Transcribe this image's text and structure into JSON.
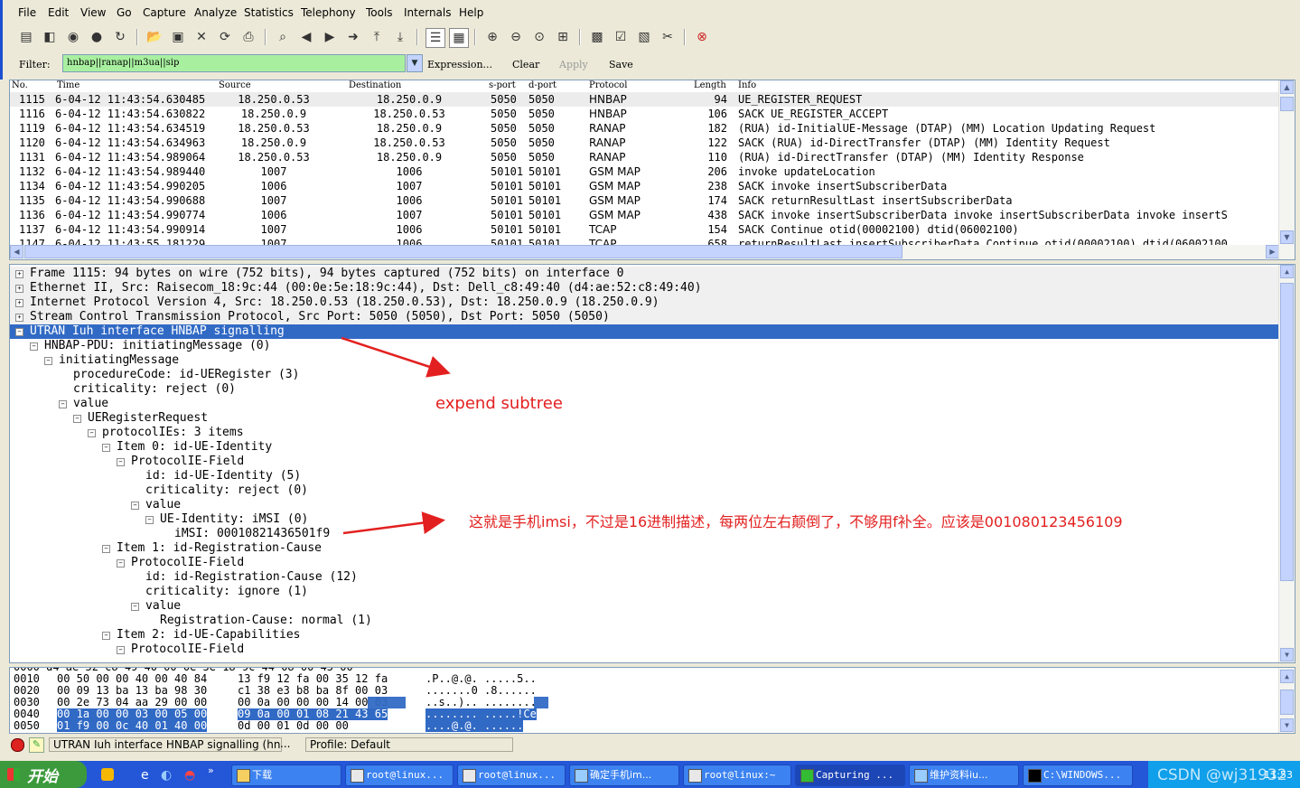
{
  "menu": [
    "File",
    "Edit",
    "View",
    "Go",
    "Capture",
    "Analyze",
    "Statistics",
    "Telephony",
    "Tools",
    "Internals",
    "Help"
  ],
  "filter": {
    "label": "Filter:",
    "value": "hnbap||ranap||m3ua||sip",
    "expression": "Expression...",
    "clear": "Clear",
    "apply": "Apply",
    "save": "Save"
  },
  "columns": [
    "No.",
    "Time",
    "Source",
    "Destination",
    "s-port",
    "d-port",
    "Protocol",
    "Length",
    "Info"
  ],
  "packets": [
    [
      "1115",
      "6-04-12 11:43:54.630485",
      "18.250.0.53",
      "18.250.0.9",
      "5050",
      "5050",
      "HNBAP",
      "94",
      "UE_REGISTER_REQUEST"
    ],
    [
      "1116",
      "6-04-12 11:43:54.630822",
      "18.250.0.9",
      "18.250.0.53",
      "5050",
      "5050",
      "HNBAP",
      "106",
      "SACK UE_REGISTER_ACCEPT"
    ],
    [
      "1119",
      "6-04-12 11:43:54.634519",
      "18.250.0.53",
      "18.250.0.9",
      "5050",
      "5050",
      "RANAP",
      "182",
      "(RUA) id-InitialUE-Message (DTAP) (MM) Location Updating Request"
    ],
    [
      "1120",
      "6-04-12 11:43:54.634963",
      "18.250.0.9",
      "18.250.0.53",
      "5050",
      "5050",
      "RANAP",
      "122",
      "SACK (RUA) id-DirectTransfer (DTAP) (MM) Identity Request"
    ],
    [
      "1131",
      "6-04-12 11:43:54.989064",
      "18.250.0.53",
      "18.250.0.9",
      "5050",
      "5050",
      "RANAP",
      "110",
      "(RUA) id-DirectTransfer (DTAP) (MM) Identity Response"
    ],
    [
      "1132",
      "6-04-12 11:43:54.989440",
      "1007",
      "1006",
      "50101",
      "50101",
      "GSM MAP",
      "206",
      "invoke updateLocation"
    ],
    [
      "1134",
      "6-04-12 11:43:54.990205",
      "1006",
      "1007",
      "50101",
      "50101",
      "GSM MAP",
      "238",
      "SACK invoke insertSubscriberData"
    ],
    [
      "1135",
      "6-04-12 11:43:54.990688",
      "1007",
      "1006",
      "50101",
      "50101",
      "GSM MAP",
      "174",
      "SACK returnResultLast insertSubscriberData"
    ],
    [
      "1136",
      "6-04-12 11:43:54.990774",
      "1006",
      "1007",
      "50101",
      "50101",
      "GSM MAP",
      "438",
      "SACK invoke insertSubscriberData invoke insertSubscriberData invoke insertS"
    ],
    [
      "1137",
      "6-04-12 11:43:54.990914",
      "1007",
      "1006",
      "50101",
      "50101",
      "TCAP",
      "154",
      "SACK Continue otid(00002100) dtid(06002100)"
    ],
    [
      "1147",
      "6-04-12 11:43:55.181229",
      "1007",
      "1006",
      "50101",
      "50101",
      "TCAP",
      "658",
      "returnResultLast insertSubscriberData Continue otid(00002100) dtid(06002100"
    ]
  ],
  "detail": [
    "Frame 1115: 94 bytes on wire (752 bits), 94 bytes captured (752 bits) on interface 0",
    "Ethernet II, Src: Raisecom_18:9c:44 (00:0e:5e:18:9c:44), Dst: Dell_c8:49:40 (d4:ae:52:c8:49:40)",
    "Internet Protocol Version 4, Src: 18.250.0.53 (18.250.0.53), Dst: 18.250.0.9 (18.250.0.9)",
    "Stream Control Transmission Protocol, Src Port: 5050 (5050), Dst Port: 5050 (5050)",
    "UTRAN Iuh interface HNBAP signalling",
    "HNBAP-PDU: initiatingMessage (0)",
    "initiatingMessage",
    "procedureCode: id-UERegister (3)",
    "criticality: reject (0)",
    "value",
    "UERegisterRequest",
    "protocolIEs: 3 items",
    "Item 0: id-UE-Identity",
    "ProtocolIE-Field",
    "id: id-UE-Identity (5)",
    "criticality: reject (0)",
    "value",
    "UE-Identity: iMSI (0)",
    "iMSI: 00010821436501f9",
    "Item 1: id-Registration-Cause",
    "ProtocolIE-Field",
    "id: id-Registration-Cause (12)",
    "criticality: ignore (1)",
    "value",
    "Registration-Cause: normal (1)",
    "Item 2: id-UE-Capabilities",
    "ProtocolIE-Field"
  ],
  "hex": [
    [
      "0010",
      "00 50 00 00 40 00 40 84",
      "13 f9 12 fa 00 35 12 fa",
      ".P..@.@. .....5.."
    ],
    [
      "0020",
      "00 09 13 ba 13 ba 98 30",
      "c1 38 e3 b8 ba 8f 00 03",
      ".......0 .8......"
    ],
    [
      "0030",
      "00 2e 73 04 aa 29 00 00",
      "00 0a 00 00 00 14 00 03",
      "..s..).. ........"
    ],
    [
      "0040",
      "00 1a 00 00 03 00 05 00",
      "09 0a 00 01 08 21 43 65",
      "........ .....!Ce"
    ],
    [
      "0050",
      "01 f9 00 0c 40 01 40 00",
      "0d 00 01 0d 00 00",
      "....@.@. ......"
    ]
  ],
  "status": {
    "text": "UTRAN Iuh interface HNBAP signalling (hn...",
    "dots": "...",
    "profile": "Profile: Default"
  },
  "taskbar": {
    "start": "开始",
    "tasks": [
      "下载",
      "root@linux...",
      "root@linux...",
      "确定手机im...",
      "root@linux:~",
      "Capturing ...",
      "维护资料iu...",
      "C:\\WINDOWS..."
    ],
    "watermark": "CSDN @wj31932",
    "clock": "11:53"
  },
  "annotations": {
    "expand": "expend  subtree",
    "imsi": "这就是手机imsi，不过是16进制描述，每两位左右颠倒了，不够用f补全。应该是001080123456109"
  },
  "colors": {
    "filter_ok": "#a8f0a0",
    "selection": "#316ac5",
    "annotation": "#e32020",
    "taskbar": "#2456d8"
  }
}
